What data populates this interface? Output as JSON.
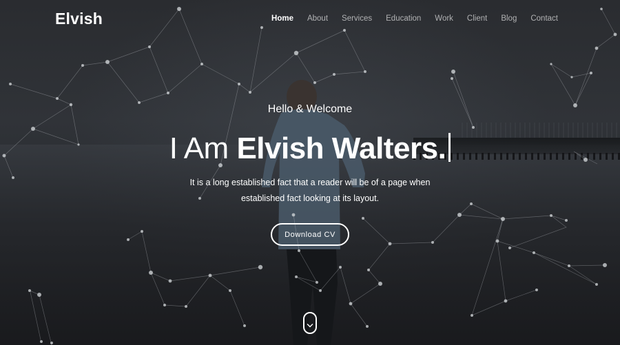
{
  "navbar": {
    "brand": "Elvish",
    "items": [
      {
        "label": "Home",
        "active": true
      },
      {
        "label": "About",
        "active": false
      },
      {
        "label": "Services",
        "active": false
      },
      {
        "label": "Education",
        "active": false
      },
      {
        "label": "Work",
        "active": false
      },
      {
        "label": "Client",
        "active": false
      },
      {
        "label": "Blog",
        "active": false
      },
      {
        "label": "Contact",
        "active": false
      }
    ]
  },
  "hero": {
    "greeting": "Hello & Welcome",
    "headline_prefix": "I Am ",
    "headline_name": "Elvish Walters.",
    "description": "It is a long established fact that a reader will be of a page when established fact looking at its layout.",
    "cta_label": "Download CV"
  },
  "icons": {
    "scroll": "chevron-down-icon"
  },
  "colors": {
    "text": "#ffffff",
    "nav_inactive": "rgba(255,255,255,0.62)",
    "background": "#2b2d31",
    "network": "#c8ccd0"
  }
}
